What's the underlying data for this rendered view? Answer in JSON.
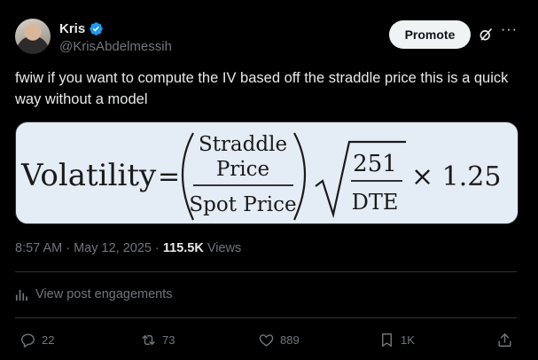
{
  "author": {
    "name": "Kris",
    "handle": "@KrisAbdelmessih"
  },
  "header": {
    "promote_label": "Promote",
    "more_label": "···"
  },
  "post": {
    "text": "fwiw if you want to compute the IV based off the straddle price this is a quick way without a model",
    "timestamp": "8:57 AM · May 12, 2025 · ",
    "views_count": "115.5K",
    "views_label": " Views",
    "engagements_label": "View post engagements"
  },
  "formula": {
    "lhs": "Volatility",
    "equals": "=",
    "num_line1": "Straddle",
    "num_line2": "Price",
    "denominator": "Spot Price",
    "sqrt_numerator": "251",
    "sqrt_denominator": "DTE",
    "multiplier": "× 1.25"
  },
  "actions": {
    "replies": "22",
    "reposts": "73",
    "likes": "889",
    "bookmarks": "1K"
  },
  "colors": {
    "background": "#000000",
    "text": "#e7e9ea",
    "muted": "#71767b",
    "verified": "#1d9bf0",
    "media_bg": "#e4ecf5"
  }
}
